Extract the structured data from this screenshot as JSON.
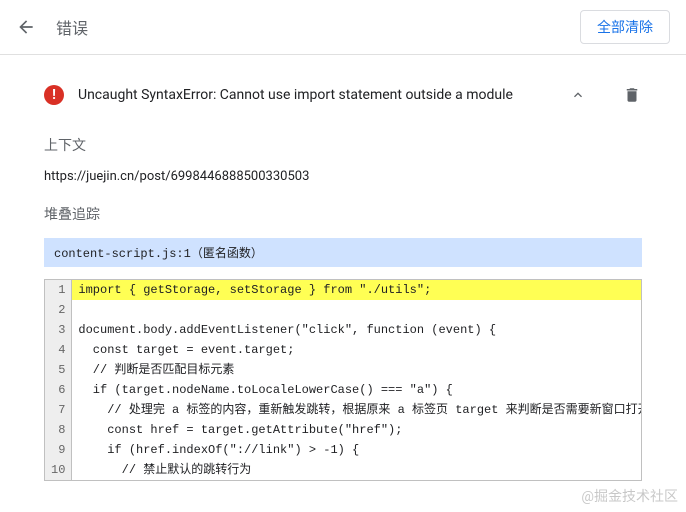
{
  "header": {
    "title": "错误",
    "clear_all": "全部清除"
  },
  "error": {
    "message": "Uncaught SyntaxError: Cannot use import statement outside a module"
  },
  "sections": {
    "context_label": "上下文",
    "context_url": "https://juejin.cn/post/6998446888500330503",
    "stack_label": "堆叠追踪",
    "stack_location": "content-script.js:1（匿名函数）"
  },
  "code": {
    "highlight_line": 1,
    "lines": [
      "import { getStorage, setStorage } from \"./utils\";",
      "",
      "document.body.addEventListener(\"click\", function (event) {",
      "  const target = event.target;",
      "  // 判断是否匹配目标元素",
      "  if (target.nodeName.toLocaleLowerCase() === \"a\") {",
      "    // 处理完 a 标签的内容，重新触发跳转，根据原来 a 标签页 target 来判断是否需要新窗口打开",
      "    const href = target.getAttribute(\"href\");",
      "    if (href.indexOf(\"://link\") > -1) {",
      "      // 禁止默认的跳转行为"
    ]
  },
  "watermark": "@掘金技术社区"
}
